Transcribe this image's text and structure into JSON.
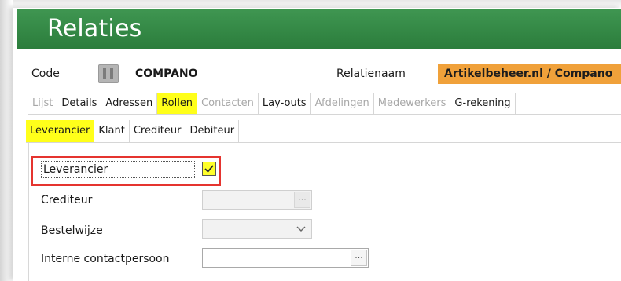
{
  "window": {
    "title": "Relaties"
  },
  "record": {
    "code_label": "Code",
    "code_value": "COMPANO",
    "relname_label": "Relatienaam",
    "relname_value": "Artikelbeheer.nl / Compano",
    "relname_color": "#f0a13a"
  },
  "tabs": [
    {
      "label": "Lijst",
      "state": "disabled"
    },
    {
      "label": "Details",
      "state": "enabled"
    },
    {
      "label": "Adressen",
      "state": "enabled"
    },
    {
      "label": "Rollen",
      "state": "active"
    },
    {
      "label": "Contacten",
      "state": "disabled"
    },
    {
      "label": "Lay-outs",
      "state": "enabled"
    },
    {
      "label": "Afdelingen",
      "state": "disabled"
    },
    {
      "label": "Medewerkers",
      "state": "disabled"
    },
    {
      "label": "G-rekening",
      "state": "enabled"
    }
  ],
  "subtabs": [
    {
      "label": "Leverancier",
      "state": "active"
    },
    {
      "label": "Klant",
      "state": "enabled"
    },
    {
      "label": "Crediteur",
      "state": "enabled"
    },
    {
      "label": "Debiteur",
      "state": "enabled"
    }
  ],
  "form": {
    "leverancier_label": "Leverancier",
    "leverancier_checked": true,
    "crediteur_label": "Crediteur",
    "crediteur_value": "",
    "bestelwijze_label": "Bestelwijze",
    "bestelwijze_value": "",
    "contact_label": "Interne contactpersoon",
    "contact_value": "",
    "ellipsis": "..."
  },
  "colors": {
    "header_green": "#2f8a44",
    "highlight_yellow": "#ffff1a",
    "annotation_red": "#e5342f"
  }
}
